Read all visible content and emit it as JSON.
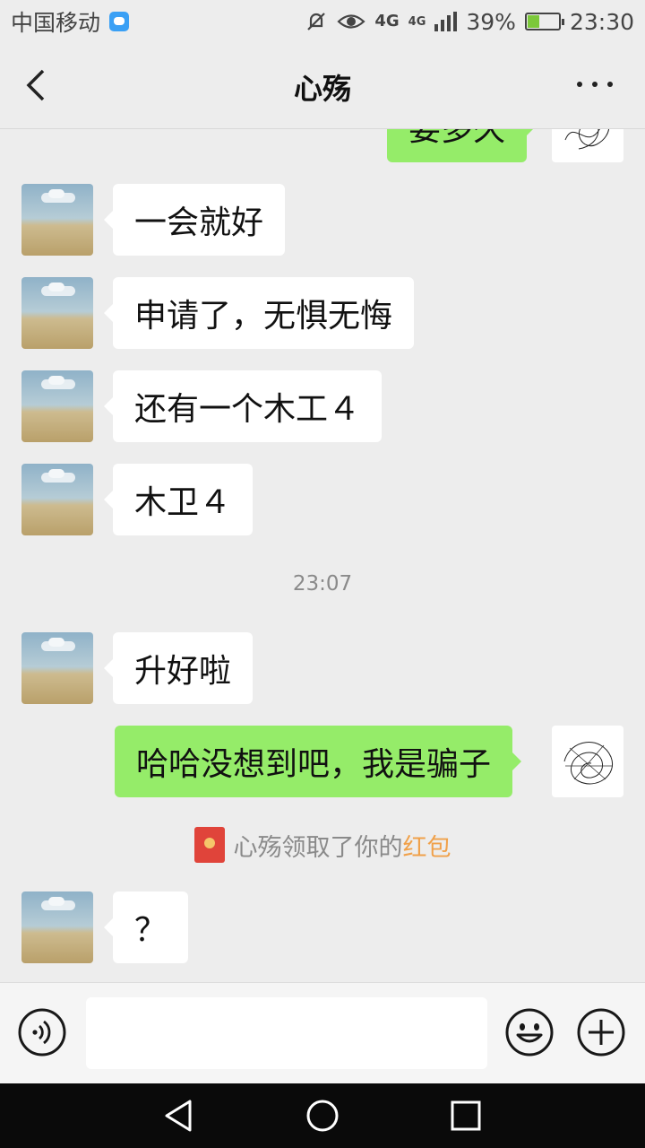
{
  "status_bar": {
    "carrier": "中国移动",
    "network_1": "4G",
    "network_2": "4G",
    "battery_percent": "39%",
    "battery_level": 0.39,
    "time": "23:30",
    "icons": [
      "message-app-icon",
      "mute-icon",
      "eye-icon",
      "signal-icon",
      "battery-charging-icon"
    ]
  },
  "header": {
    "title": "心殇",
    "back_icon": "chevron-left-icon",
    "more_icon": "more-dots-icon"
  },
  "chat": {
    "partial_top_message": "要多久",
    "messages_before": [
      "一会就好",
      "申请了，无惧无悔",
      "还有一个木工４",
      "木卫４"
    ],
    "time_separator": "23:07",
    "incoming_after_time": "升好啦",
    "outgoing_message": "哈哈没想到吧，我是骗子",
    "system_notice": {
      "prefix": "心殇领取了你的",
      "highlight": "红包",
      "icon": "red-envelope-icon",
      "highlight_color": "#f0a14a"
    },
    "last_incoming": "？"
  },
  "input_bar": {
    "voice_icon": "voice-icon",
    "input_value": "",
    "emoji_icon": "emoji-icon",
    "plus_icon": "plus-icon"
  },
  "nav_bar": {
    "icons": [
      "back-triangle-icon",
      "home-circle-icon",
      "recents-square-icon"
    ]
  },
  "colors": {
    "background": "#ededed",
    "outgoing_bubble": "#95ec69",
    "incoming_bubble": "#ffffff"
  }
}
